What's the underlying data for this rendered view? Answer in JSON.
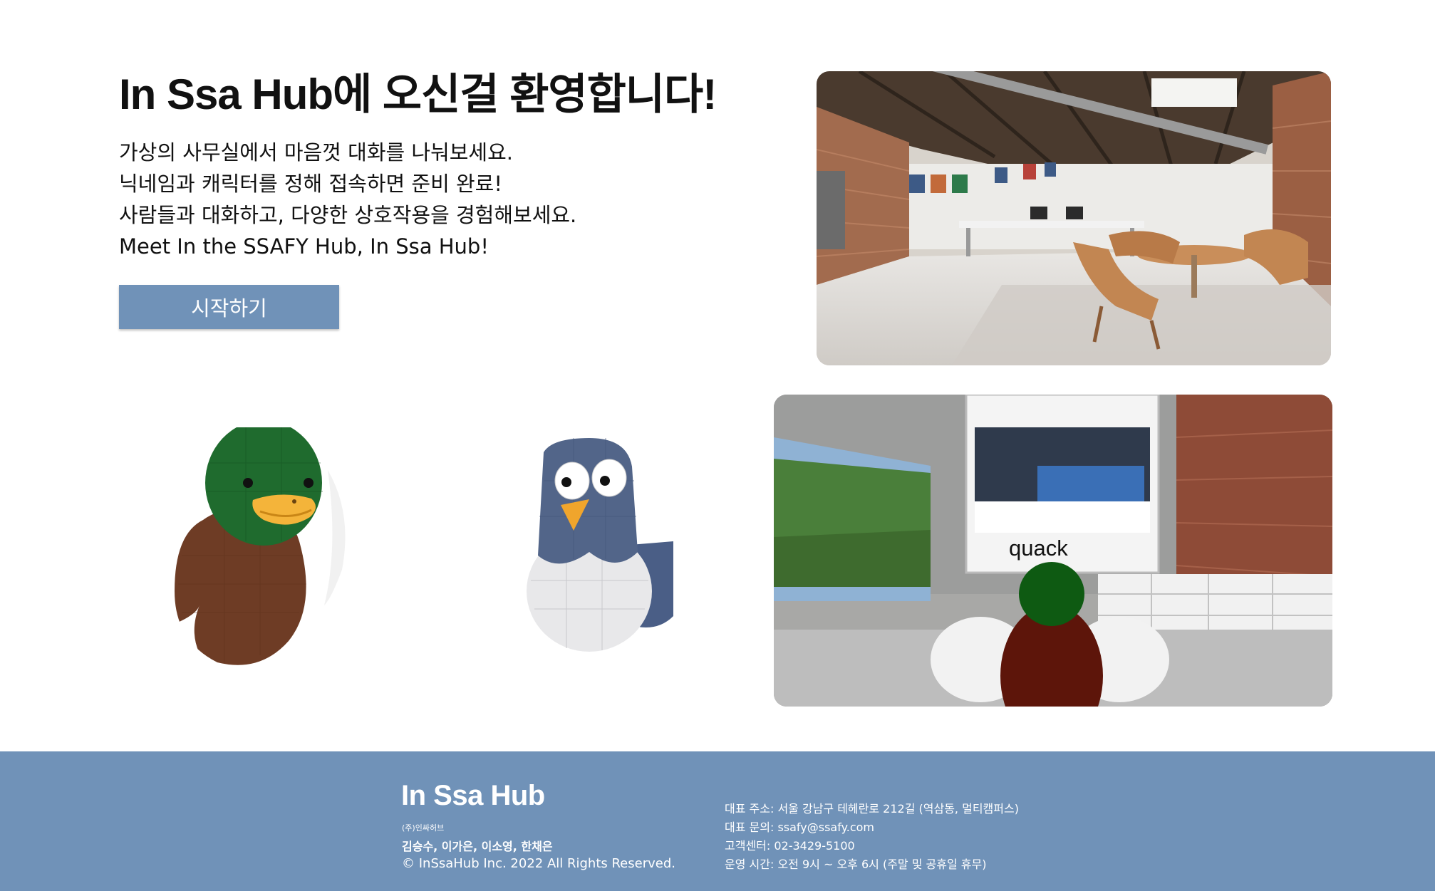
{
  "hero": {
    "title": "In Ssa Hub에 오신걸 환영합니다!",
    "lines": [
      "가상의 사무실에서 마음껏 대화를 나눠보세요.",
      "닉네임과 캐릭터를 정해 접속하면 준비 완료!",
      "사람들과 대화하고, 다양한 상호작용을 경험해보세요.",
      "Meet In the SSAFY Hub, In Ssa Hub!"
    ],
    "start_label": "시작하기"
  },
  "images": {
    "office_icon": "office-interior-photo",
    "duck_icon": "mallard-duck-character",
    "pigeon_icon": "pigeon-character",
    "vr_icon": "virtual-office-scene",
    "vr_caption": "quack"
  },
  "footer": {
    "brand": "In Ssa Hub",
    "company": "(주)인싸허브",
    "members": "김승수, 이가은, 이소영, 한채은",
    "copyright": "© InSsaHub Inc. 2022 All Rights Reserved.",
    "info": [
      "대표 주소: 서울 강남구 테헤란로 212길 (역삼동, 멀티캠퍼스)",
      "대표 문의: ssafy@ssafy.com",
      "고객센터: 02-3429-5100",
      "운영 시간: 오전 9시 ~ 오후 6시 (주말 및 공휴일 휴무)"
    ]
  },
  "colors": {
    "accent": "#7092b8",
    "text": "#111111",
    "white": "#ffffff"
  }
}
